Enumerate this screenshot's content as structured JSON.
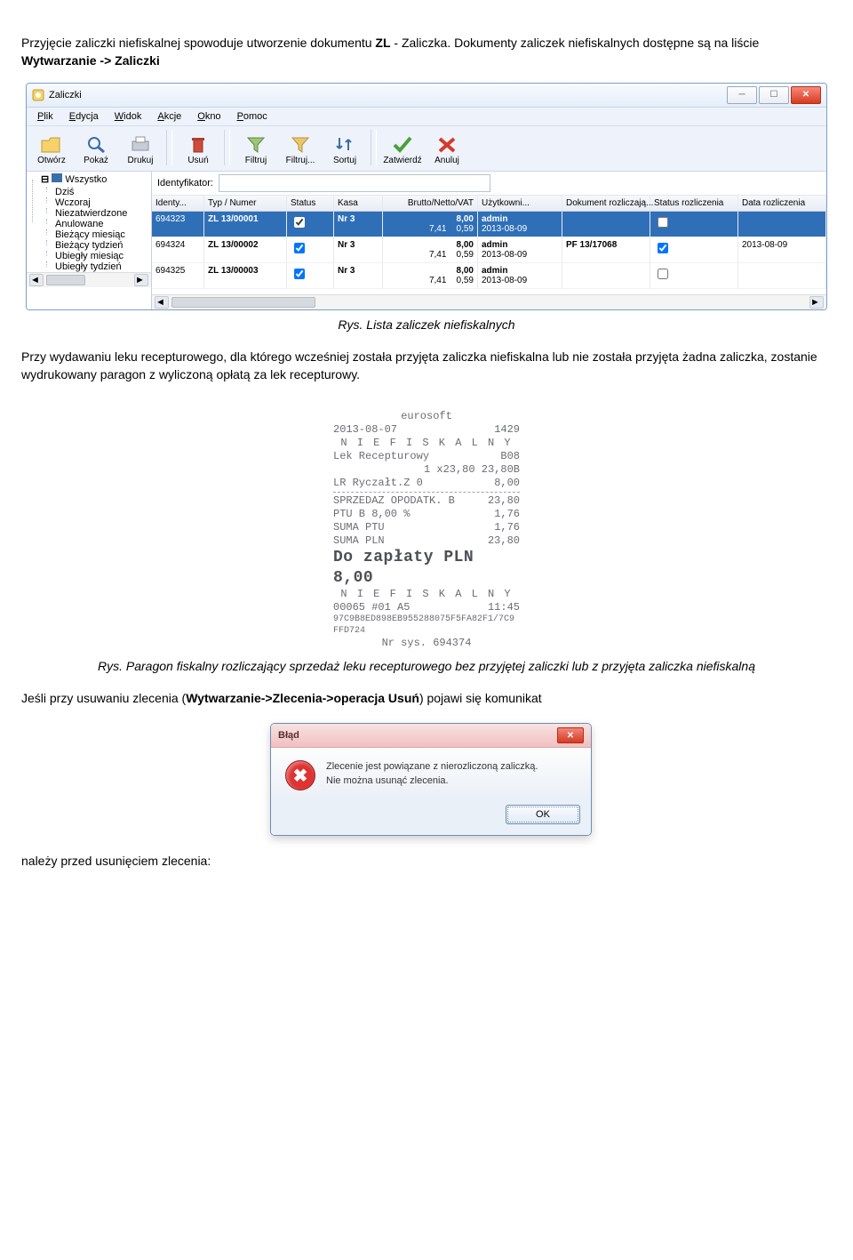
{
  "intro": {
    "p1a": "Przyjęcie zaliczki niefiskalnej spowoduje utworzenie dokumentu ",
    "p1b": "ZL",
    "p1c": " - Zaliczka. Dokumenty zaliczek niefiskalnych dostępne są na liście ",
    "p1d": "Wytwarzanie -> Zaliczki"
  },
  "window": {
    "title": "Zaliczki",
    "menu": [
      "Plik",
      "Edycja",
      "Widok",
      "Akcje",
      "Okno",
      "Pomoc"
    ],
    "tools": [
      "Otwórz",
      "Pokaż",
      "Drukuj",
      "Usuń",
      "Filtruj",
      "Filtruj...",
      "Sortuj",
      "Zatwierdź",
      "Anuluj"
    ],
    "identLabel": "Identyfikator:",
    "tree": [
      "Wszystko",
      "Dziś",
      "Wczoraj",
      "Niezatwierdzone",
      "Anulowane",
      "Bieżący miesiąc",
      "Bieżący tydzień",
      "Ubiegły miesiąc",
      "Ubiegły tydzień"
    ],
    "columns": [
      "Identy...",
      "Typ / Numer",
      "Status",
      "Kasa",
      "Brutto/Netto/VAT",
      "Użytkowni...",
      "Dokument rozliczają...",
      "Status rozliczenia",
      "Data rozliczenia"
    ],
    "rows": [
      {
        "id": "694323",
        "doc": "ZL  13/00001",
        "chk": true,
        "kasa": "Nr 3",
        "b": "8,00",
        "n": "7,41",
        "v": "0,59",
        "user": "admin",
        "date": "2013-08-09",
        "rozl": "",
        "rchk": false,
        "rdate": ""
      },
      {
        "id": "694324",
        "doc": "ZL  13/00002",
        "chk": true,
        "kasa": "Nr 3",
        "b": "8,00",
        "n": "7,41",
        "v": "0,59",
        "user": "admin",
        "date": "2013-08-09",
        "rozl": "PF  13/17068",
        "rchk": true,
        "rdate": "2013-08-09"
      },
      {
        "id": "694325",
        "doc": "ZL  13/00003",
        "chk": true,
        "kasa": "Nr 3",
        "b": "8,00",
        "n": "7,41",
        "v": "0,59",
        "user": "admin",
        "date": "2013-08-09",
        "rozl": "",
        "rchk": false,
        "rdate": ""
      }
    ]
  },
  "caption1": "Rys. Lista zaliczek niefiskalnych",
  "para2": "Przy wydawaniu leku recepturowego, dla którego wcześniej została przyjęta zaliczka niefiskalna lub nie została przyjęta żadna zaliczka, zostanie wydrukowany paragon z wyliczoną opłatą za lek recepturowy.",
  "receipt": {
    "brand": "eurosoft",
    "l1a": "2013-08-07",
    "l1b": "1429",
    "nf": "N I E F I S K A L N Y",
    "l2a": "Lek Recepturowy",
    "l2b": "B08",
    "l3a": "",
    "l3b": "1 x23,80 23,80B",
    "l4a": "LR Ryczałt.Z 0",
    "l4b": "8,00",
    "l5a": "SPRZEDAZ OPODATK. B",
    "l5b": "23,80",
    "l6a": "PTU B 8,00 %",
    "l6b": "1,76",
    "l7a": "SUMA PTU",
    "l7b": "1,76",
    "l8a": "SUMA PLN",
    "l8b": "23,80",
    "big": "Do zapłaty PLN  8,00",
    "l9a": "00065 #01        A5",
    "l9b": "11:45",
    "hash": "97C9B8ED898EB955288075F5FA82F1/7C9FFD724",
    "sys": "Nr sys. 694374"
  },
  "caption2": "Rys. Paragon fiskalny rozliczający sprzedaż leku recepturowego bez przyjętej zaliczki lub z przyjęta zaliczka niefiskalną",
  "para3a": "Jeśli przy usuwaniu zlecenia (",
  "para3b": "Wytwarzanie->Zlecenia->operacja Usuń",
  "para3c": ") pojawi się komunikat",
  "dlg": {
    "title": "Błąd",
    "line1": "Zlecenie jest powiązane z nierozliczoną zaliczką.",
    "line2": "Nie można usunąć zlecenia.",
    "ok": "OK"
  },
  "footer": "należy przed usunięciem zlecenia:"
}
